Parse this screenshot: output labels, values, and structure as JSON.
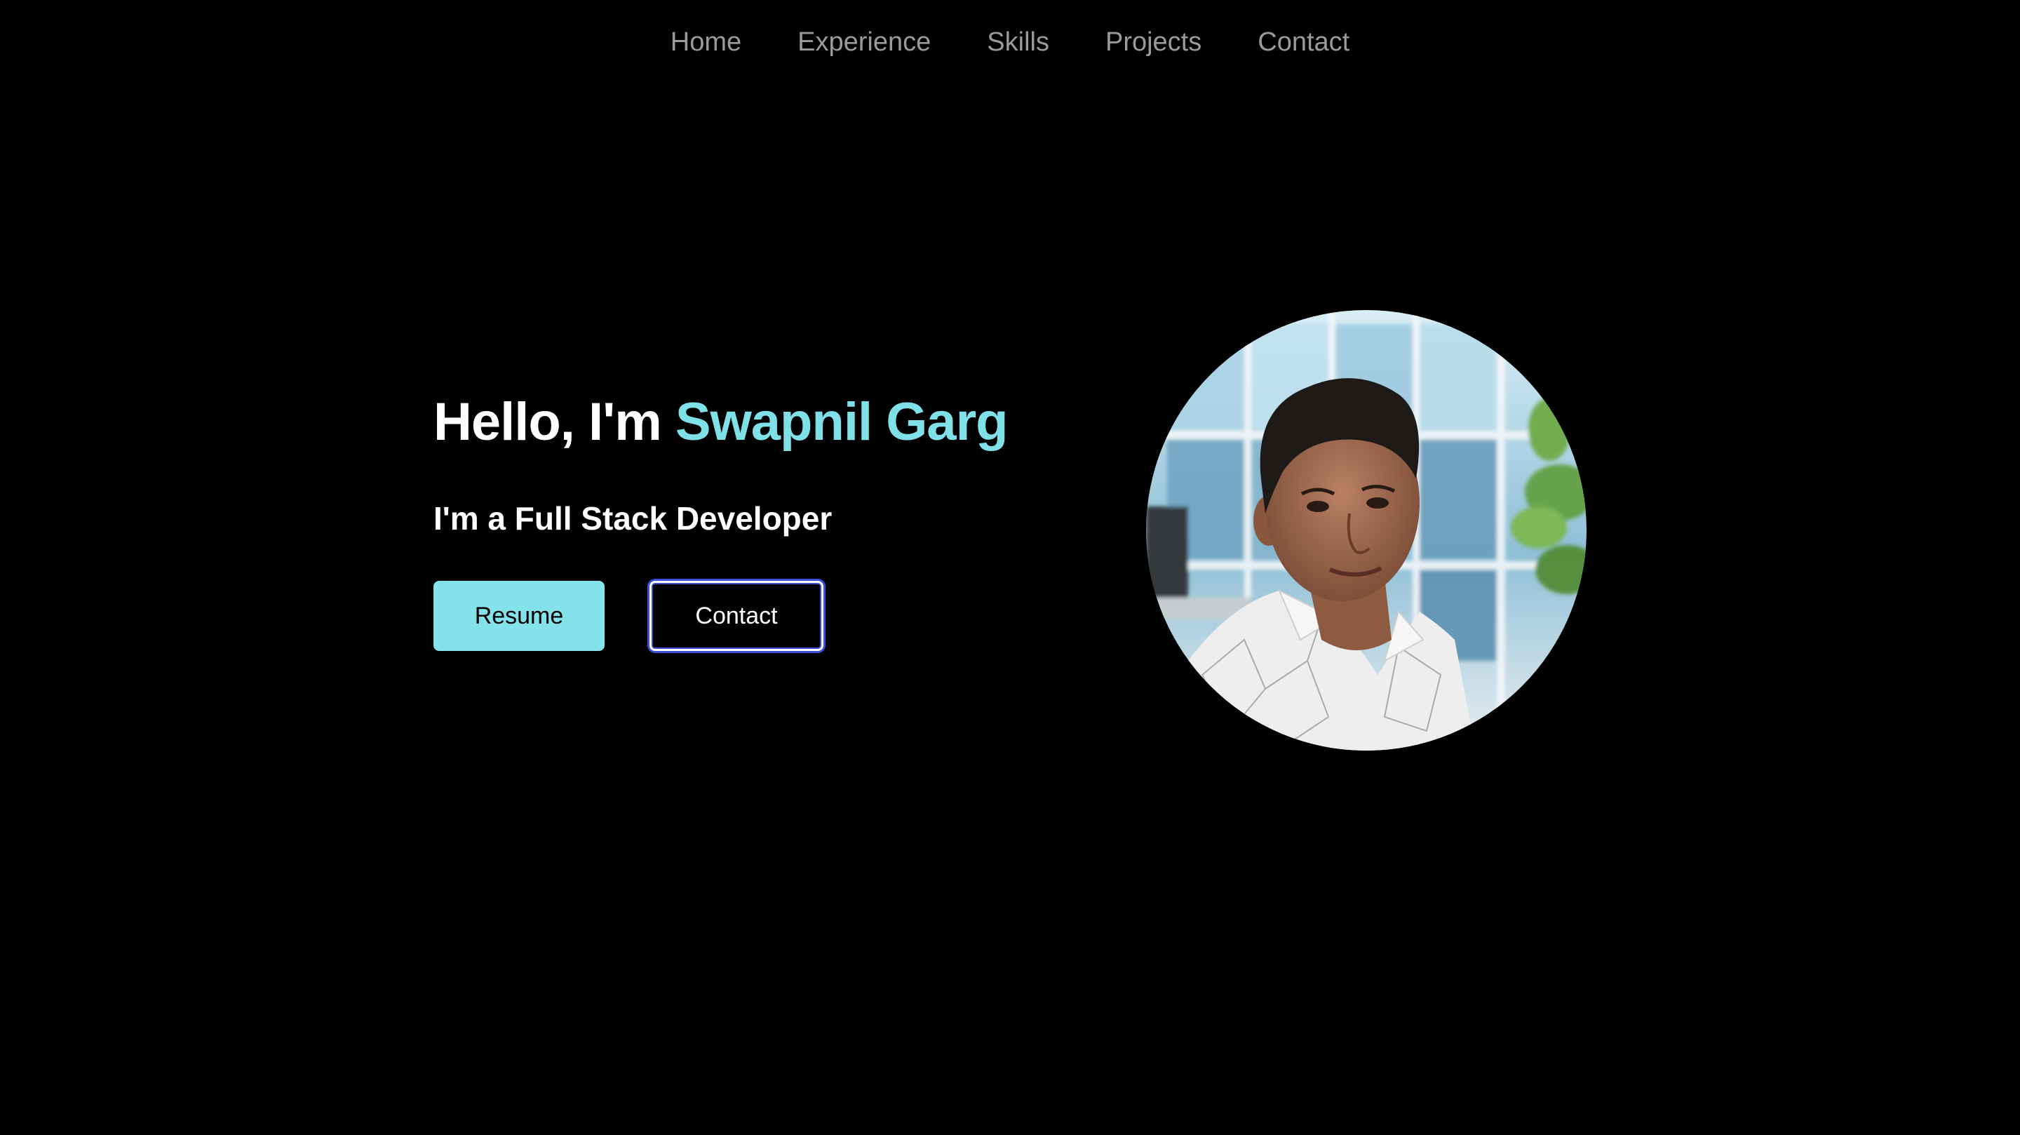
{
  "nav": {
    "items": [
      {
        "label": "Home"
      },
      {
        "label": "Experience"
      },
      {
        "label": "Skills"
      },
      {
        "label": "Projects"
      },
      {
        "label": "Contact"
      }
    ]
  },
  "hero": {
    "greeting": "Hello, I'm ",
    "name": "Swapnil Garg",
    "subtitle": "I'm a Full Stack Developer",
    "resume_label": "Resume",
    "contact_label": "Contact"
  },
  "colors": {
    "background": "#000000",
    "accent": "#7fe0e8",
    "nav_text": "#9a9a9a",
    "button_outline": "#3b4fd8"
  },
  "icons": {
    "avatar": "profile-photo"
  }
}
